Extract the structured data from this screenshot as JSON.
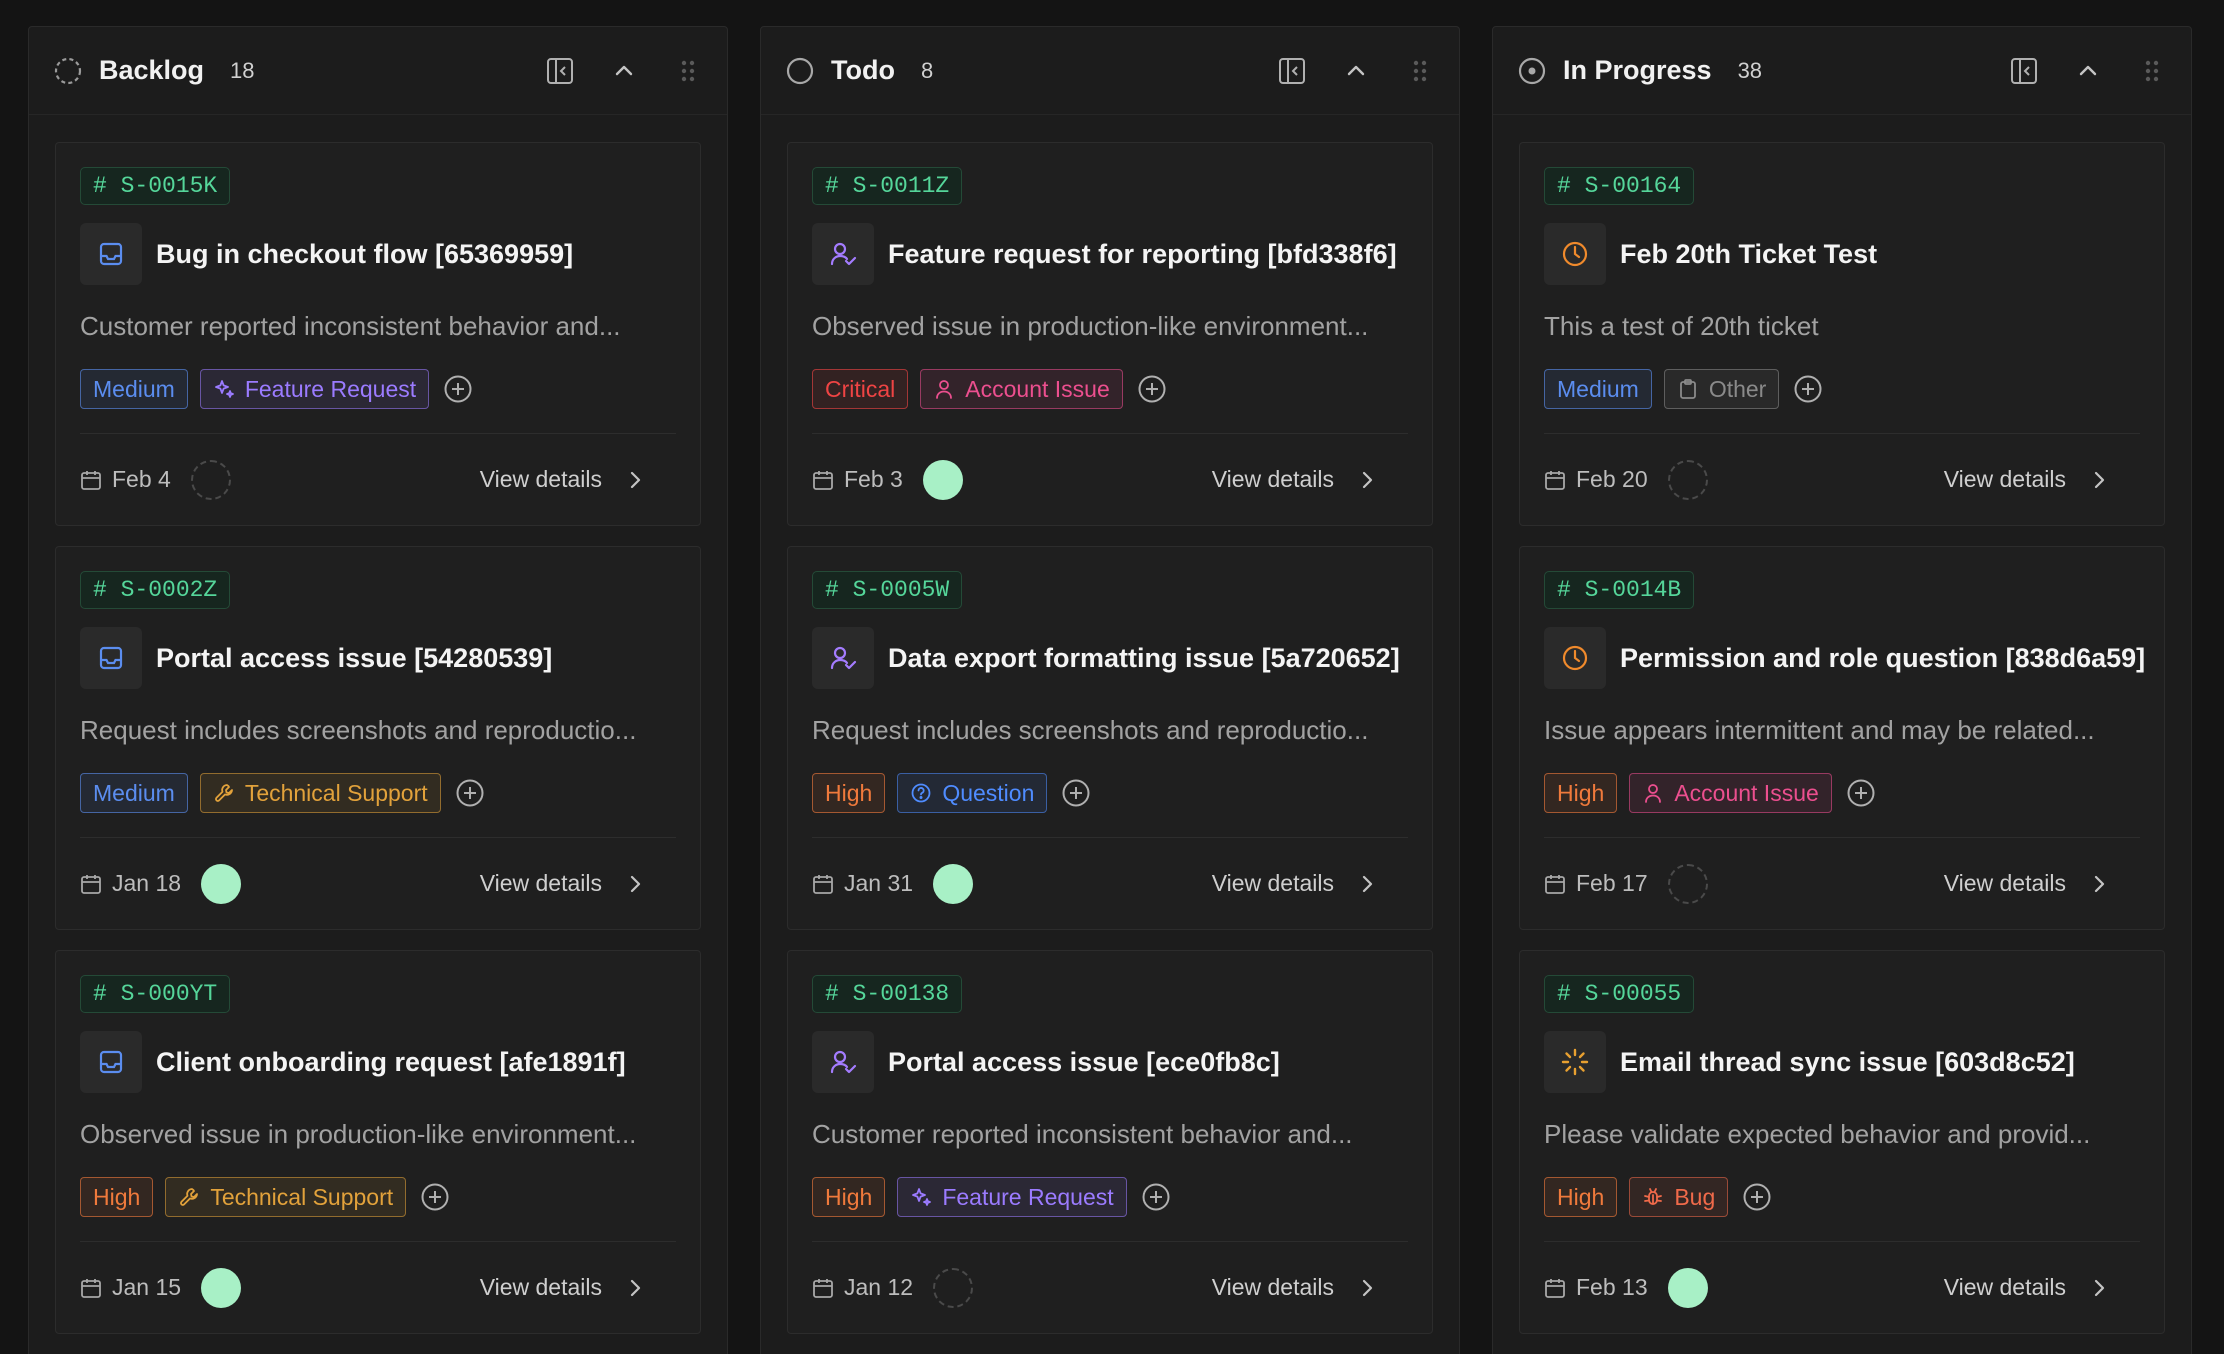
{
  "colors": {
    "medium": "#5b8def",
    "high": "#f07a3c",
    "critical": "#ef4444",
    "feature": "#9b7bff",
    "technical": "#e2a23b",
    "account": "#ec4f8f",
    "question": "#4f8cff",
    "other": "#8a8a8a",
    "bug": "#f06a4a",
    "id_green": "#55d69a"
  },
  "columns": [
    {
      "title": "Backlog",
      "count": "18",
      "status_icon": "dashed-circle-icon",
      "cards": [
        {
          "id": "# S-0015K",
          "type_icon": "inbox-icon",
          "title": "Bug in checkout flow [65369959]",
          "desc": "Customer reported inconsistent behavior and...",
          "priority": "Medium",
          "priority_kind": "medium",
          "category": "Feature Request",
          "category_kind": "feature",
          "date": "Feb 4",
          "assignee": "empty",
          "action": "View details"
        },
        {
          "id": "# S-0002Z",
          "type_icon": "inbox-icon",
          "title": "Portal access issue [54280539]",
          "desc": "Request includes screenshots and reproductio...",
          "priority": "Medium",
          "priority_kind": "medium",
          "category": "Technical Support",
          "category_kind": "technical",
          "date": "Jan 18",
          "assignee": "filled",
          "action": "View details"
        },
        {
          "id": "# S-000YT",
          "type_icon": "inbox-icon",
          "title": "Client onboarding request [afe1891f]",
          "desc": "Observed issue in production-like environment...",
          "priority": "High",
          "priority_kind": "high",
          "category": "Technical Support",
          "category_kind": "technical",
          "date": "Jan 15",
          "assignee": "filled",
          "action": "View details"
        }
      ]
    },
    {
      "title": "Todo",
      "count": "8",
      "status_icon": "circle-icon",
      "cards": [
        {
          "id": "# S-0011Z",
          "type_icon": "user-check-icon",
          "title": "Feature request for reporting [bfd338f6]",
          "desc": "Observed issue in production-like environment...",
          "priority": "Critical",
          "priority_kind": "critical",
          "category": "Account Issue",
          "category_kind": "account",
          "date": "Feb 3",
          "assignee": "filled",
          "action": "View details"
        },
        {
          "id": "# S-0005W",
          "type_icon": "user-check-icon",
          "title": "Data export formatting issue [5a720652]",
          "desc": "Request includes screenshots and reproductio...",
          "priority": "High",
          "priority_kind": "high",
          "category": "Question",
          "category_kind": "question",
          "date": "Jan 31",
          "assignee": "filled",
          "action": "View details"
        },
        {
          "id": "# S-00138",
          "type_icon": "user-check-icon",
          "title": "Portal access issue [ece0fb8c]",
          "desc": "Customer reported inconsistent behavior and...",
          "priority": "High",
          "priority_kind": "high",
          "category": "Feature Request",
          "category_kind": "feature",
          "date": "Jan 12",
          "assignee": "empty",
          "action": "View details"
        }
      ]
    },
    {
      "title": "In Progress",
      "count": "38",
      "status_icon": "dot-circle-icon",
      "cards": [
        {
          "id": "# S-00164",
          "type_icon": "clock-icon",
          "title": "Feb 20th Ticket Test",
          "desc": "This a test of 20th ticket",
          "priority": "Medium",
          "priority_kind": "medium",
          "category": "Other",
          "category_kind": "other",
          "date": "Feb 20",
          "assignee": "empty",
          "action": "View details"
        },
        {
          "id": "# S-0014B",
          "type_icon": "clock-icon",
          "title": "Permission and role question [838d6a59]",
          "desc": "Issue appears intermittent and may be related...",
          "priority": "High",
          "priority_kind": "high",
          "category": "Account Issue",
          "category_kind": "account",
          "date": "Feb 17",
          "assignee": "empty",
          "action": "View details"
        },
        {
          "id": "# S-00055",
          "type_icon": "loader-icon",
          "title": "Email thread sync issue [603d8c52]",
          "desc": "Please validate expected behavior and provid...",
          "priority": "High",
          "priority_kind": "high",
          "category": "Bug",
          "category_kind": "bug",
          "date": "Feb 13",
          "assignee": "filled",
          "action": "View details"
        }
      ]
    }
  ]
}
